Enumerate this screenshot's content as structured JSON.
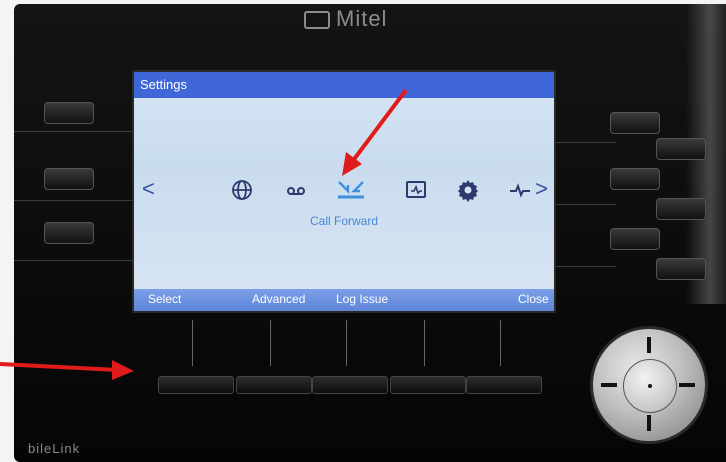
{
  "brand": {
    "name": "Mitel"
  },
  "screen": {
    "title": "Settings",
    "nav_left": "<",
    "nav_right": ">",
    "icons": [
      {
        "name": "globe-icon"
      },
      {
        "name": "voicemail-icon"
      },
      {
        "name": "call-forward-icon"
      },
      {
        "name": "monitor-icon"
      },
      {
        "name": "gear-icon"
      },
      {
        "name": "diagnostics-icon"
      }
    ],
    "selected_label": "Call Forward",
    "softkeys": [
      "Select",
      "Advanced",
      "Log Issue",
      "Close"
    ]
  },
  "watermark": "bileLink",
  "colors": {
    "header": "#3f67d8",
    "softkey_bar": "#6a8fe0",
    "annotation_arrow": "#e01b1b"
  }
}
